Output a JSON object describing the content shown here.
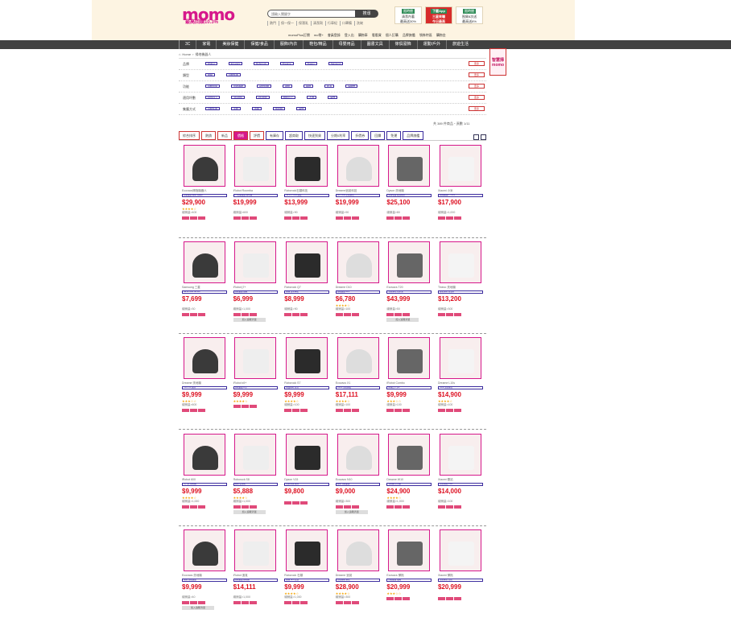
{
  "header": {
    "logo_text": "momo",
    "logo_sub": "最高回饋10.3%",
    "search_placeholder": "請輸入關鍵字",
    "search_button": "搜尋",
    "hot_words": [
      "熱門",
      "保一保一",
      "保濕乳",
      "清潔劑",
      "行車紀",
      "口罩備",
      "洗碗"
    ],
    "promos": [
      {
        "tag": "限時搶",
        "line1": "清潔內著",
        "line2": "最高送30%",
        "style": "white"
      },
      {
        "tag": "下載App",
        "line1": "三星來囉",
        "line2": "今日最高",
        "style": "red"
      },
      {
        "tag": "限時搶",
        "line1": "囤貨8次送",
        "line2": "最高送8%",
        "style": "white"
      }
    ],
    "top_links": [
      "momoPlus訂閱",
      "mo幣+",
      "會員登錄",
      "登入出",
      "購物車",
      "看看買",
      "個人訂購",
      "品牌旗艦",
      "領券特區",
      "購物金"
    ]
  },
  "nav": [
    "3C",
    "家電",
    "美妝保健",
    "保健/食品",
    "服飾/內衣",
    "鞋包/精品",
    "母嬰用品",
    "圖書文具",
    "傢俱寢飾",
    "運動/戶外",
    "旅遊生活"
  ],
  "breadcrumb": [
    "Home",
    "掃地機器人"
  ],
  "side_ad": "智慧掃 momo",
  "filters": [
    {
      "label": "品牌",
      "options": [
        "iRobot",
        "Ecovacs",
        "Roborock",
        "Dreame",
        "Xiaomi",
        "Samsung"
      ],
      "more": "更多"
    },
    {
      "label": "類型",
      "options": [
        "掃拖",
        "自動集塵"
      ],
      "more": "更多"
    },
    {
      "label": "功能",
      "options": [
        "自動回充",
        "雷射導航",
        "APP控制",
        "避障",
        "拖地",
        "乾濕",
        "多樓層"
      ],
      "more": "更多"
    },
    {
      "label": "適用坪數",
      "options": [
        "10坪以下",
        "10-20坪",
        "20-30坪",
        "30坪以上",
        "不限",
        "其他"
      ],
      "more": "更多"
    },
    {
      "label": "集塵方式",
      "options": [
        "自動集塵",
        "手動",
        "水箱",
        "雙水箱",
        "其他"
      ],
      "more": "更多"
    }
  ],
  "result_count": "共 389 件商品・頁數 1/11",
  "sort": {
    "buttons": [
      "綜合排序",
      "熱銷",
      "新品",
      "價格",
      "評價"
    ],
    "active_index": 3,
    "filters": [
      "有庫存",
      "超商取",
      "快速到貨",
      "分期0利率",
      "折價券",
      "回饋",
      "免運",
      "品牌旗艦"
    ]
  },
  "products": [
    {
      "name": "Ecovacs掃拖機器人",
      "desc": "自動集塵 掃拖 洗拖布",
      "price": "$29,900",
      "stars": "★★★★☆",
      "sold": "總銷量>400",
      "btn": ""
    },
    {
      "name": "iRobot Roomba",
      "desc": "i7+自動集塵 掃地機",
      "price": "$19,999",
      "stars": "",
      "sold": "總銷量>600",
      "btn": ""
    },
    {
      "name": "Roborock石頭科技",
      "desc": "S8 Pro Ultra 旗艦",
      "price": "$13,999",
      "stars": "",
      "sold": "總銷量>90",
      "btn": ""
    },
    {
      "name": "Dreame追覓科技",
      "desc": "L20 Ultra 全能基站",
      "price": "$19,999",
      "stars": "",
      "sold": "總銷量>90",
      "btn": ""
    },
    {
      "name": "Dyson 洗地機",
      "desc": "無線吸塵 乾濕兩用",
      "price": "$25,100",
      "stars": "",
      "sold": "總銷量>80",
      "btn": ""
    },
    {
      "name": "Xiaomi 小米",
      "desc": "掃拖機器人 X10+",
      "price": "$17,900",
      "stars": "",
      "sold": "總銷量>1,000",
      "btn": ""
    },
    {
      "name": "Samsung 三星",
      "desc": "BESPOKE Jet Bot",
      "price": "$7,699",
      "stars": "",
      "sold": "總銷量>30",
      "btn": ""
    },
    {
      "name": "iRobot j7+",
      "desc": "自動集塵 避障",
      "price": "$6,999",
      "stars": "",
      "sold": "總銷量>1,000",
      "btn": "加入追蹤清單"
    },
    {
      "name": "Roborock Q7",
      "desc": "掃拖 雷射導航",
      "price": "$8,999",
      "stars": "",
      "sold": "總銷量>90",
      "btn": ""
    },
    {
      "name": "Dreame D10",
      "desc": "自動集塵 APP",
      "price": "$6,780",
      "stars": "★★★★☆",
      "sold": "總銷量>100",
      "btn": ""
    },
    {
      "name": "Ecovacs T20",
      "desc": "全能基站 熱水洗",
      "price": "$43,999",
      "stars": "",
      "sold": "總銷量>50",
      "btn": "加入追蹤清單"
    },
    {
      "name": "Tineco 洗地機",
      "desc": "智能洗地 自清潔",
      "price": "$13,200",
      "stars": "",
      "sold": "總銷量>300",
      "btn": ""
    },
    {
      "name": "Dreame 洗地機",
      "desc": "H12 Pro 無線",
      "price": "$9,999",
      "stars": "★★★☆☆",
      "sold": "總銷量>600",
      "btn": ""
    },
    {
      "name": "iRobot s9+",
      "desc": "自動集塵 D型",
      "price": "$9,999",
      "stars": "★★★★☆",
      "sold": "",
      "btn": ""
    },
    {
      "name": "Roborock S7",
      "desc": "聲波拖地 自清",
      "price": "$9,999",
      "stars": "★★★★☆",
      "sold": "總銷量>100",
      "btn": ""
    },
    {
      "name": "Ecovacs X1",
      "desc": "OMNI 全能旗艦",
      "price": "$17,111",
      "stars": "★★★★☆",
      "sold": "總銷量>100",
      "btn": ""
    },
    {
      "name": "iRobot Combo",
      "desc": "掃拖合一 j5+",
      "price": "$9,999",
      "stars": "★★★☆☆",
      "sold": "總銷量>100",
      "btn": ""
    },
    {
      "name": "Dreame L10s",
      "desc": "Ultra 全能基站",
      "price": "$14,900",
      "stars": "★★★★☆",
      "sold": "總銷量>100",
      "btn": ""
    },
    {
      "name": "iRobot 600",
      "desc": "入門款 掃地機",
      "price": "$9,999",
      "stars": "★★★★☆",
      "sold": "總銷量>1,000",
      "btn": ""
    },
    {
      "name": "Roborock S8",
      "desc": "掃拖 雙滾刷",
      "price": "$5,888",
      "stars": "★★★★☆",
      "sold": "總銷量>1,000",
      "btn": "加入追蹤清單"
    },
    {
      "name": "Dyson V15",
      "desc": "雷射偵測 無線",
      "price": "$9,800",
      "stars": "",
      "sold": "",
      "btn": ""
    },
    {
      "name": "Ecovacs N10",
      "desc": "掃拖 自動集塵",
      "price": "$9,000",
      "stars": "",
      "sold": "總銷量>300",
      "btn": "加入追蹤清單"
    },
    {
      "name": "Dreame W10",
      "desc": "洗地機 全自動",
      "price": "$24,900",
      "stars": "★★★★☆",
      "sold": "總銷量>1,000",
      "btn": ""
    },
    {
      "name": "Xiaomi 基站",
      "desc": "全能掃拖 S10+",
      "price": "$14,000",
      "stars": "",
      "sold": "總銷量>100",
      "btn": ""
    },
    {
      "name": "Ecovacs 洗地機",
      "desc": "掃拖 自動集塵",
      "price": "$9,999",
      "stars": "",
      "sold": "總銷量>40",
      "btn": "加入追蹤清單"
    },
    {
      "name": "iRobot 追覓",
      "desc": "自動集塵 掃地機",
      "price": "$14,111",
      "stars": "",
      "sold": "總銷量>1,000",
      "btn": ""
    },
    {
      "name": "Roborock 石頭",
      "desc": "掃拖 APP控制",
      "price": "$9,999",
      "stars": "★★★★☆",
      "sold": "總銷量>1,000",
      "btn": ""
    },
    {
      "name": "Dreame 追覓",
      "desc": "全能掃拖 基站",
      "price": "$28,900",
      "stars": "★★★★☆",
      "sold": "總銷量>300",
      "btn": ""
    },
    {
      "name": "Ecovacs 掃拖",
      "desc": "自動集塵 避障",
      "price": "$20,999",
      "stars": "★★★☆☆",
      "sold": "",
      "btn": ""
    },
    {
      "name": "Xiaomi 掃拖",
      "desc": "全能基站 白色",
      "price": "$20,999",
      "stars": "",
      "sold": "",
      "btn": ""
    }
  ]
}
